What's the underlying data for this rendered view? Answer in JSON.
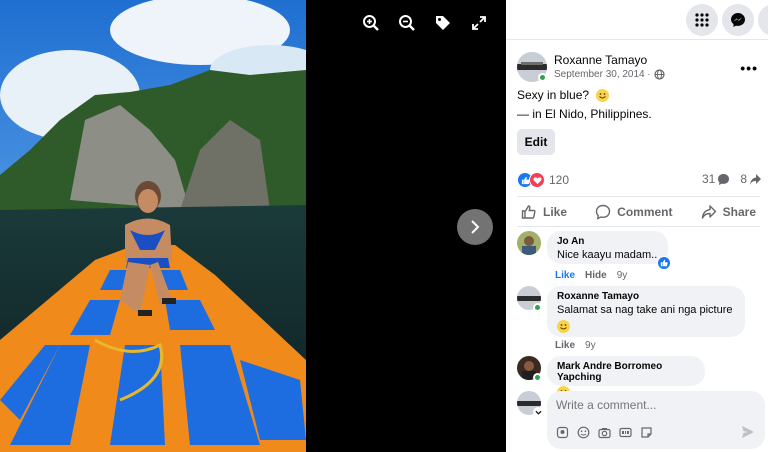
{
  "viewer": {
    "tools": [
      "zoom-in-icon",
      "zoom-out-icon",
      "tag-icon",
      "fullscreen-icon"
    ],
    "next_icon": "chevron-right-icon"
  },
  "topbar": {
    "buttons": [
      "menu-grid-icon",
      "messenger-icon",
      "account-icon"
    ]
  },
  "post": {
    "author": "Roxanne Tamayo",
    "date": "September 30, 2014 ·",
    "privacy_icon": "globe-icon",
    "caption": "Sexy in blue?",
    "location_prefix": "— in",
    "location": "El Nido, Philippines.",
    "edit_label": "Edit",
    "reaction_count": "120",
    "comment_count": "31",
    "share_count": "8",
    "actions": {
      "like": "Like",
      "comment": "Comment",
      "share": "Share"
    }
  },
  "comments": [
    {
      "name": "Jo An",
      "text": "Nice kaayu madam..",
      "like": "Like",
      "hide": "Hide",
      "age": "9y"
    },
    {
      "name": "Roxanne Tamayo",
      "text": "Salamat sa nag take ani nga picture",
      "like": "Like",
      "age": "9y"
    },
    {
      "name": "Mark Andre Borromeo Yapching",
      "text": ""
    }
  ],
  "composer": {
    "placeholder": "Write a comment..."
  },
  "colors": {
    "accent": "#1877f2",
    "online": "#31a24c",
    "love": "#f33e58"
  }
}
